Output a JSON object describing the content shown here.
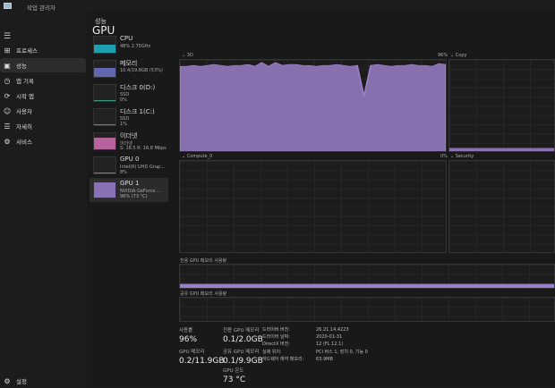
{
  "window": {
    "title": "작업 관리자"
  },
  "sidebar": {
    "items": [
      {
        "icon": "process-icon",
        "glyph": "⊞",
        "label": "프로세스"
      },
      {
        "icon": "performance-icon",
        "glyph": "▣",
        "label": "성능"
      },
      {
        "icon": "history-icon",
        "glyph": "◷",
        "label": "앱 기록"
      },
      {
        "icon": "startup-icon",
        "glyph": "⟳",
        "label": "시작 앱"
      },
      {
        "icon": "users-icon",
        "glyph": "☺",
        "label": "사용자"
      },
      {
        "icon": "details-icon",
        "glyph": "☰",
        "label": "자세히"
      },
      {
        "icon": "services-icon",
        "glyph": "⚙",
        "label": "서비스"
      }
    ],
    "settings": "설정"
  },
  "header": "성능",
  "perf_list": [
    {
      "name": "CPU",
      "sub1": "48% 2.75GHz",
      "color": "#1fb5c8",
      "fill": 48
    },
    {
      "name": "메모리",
      "sub1": "10.4/19.8GB (53%)",
      "color": "#6c72c9",
      "fill": 53
    },
    {
      "name": "디스크 0(D:)",
      "sub1": "SSD",
      "sub2": "0%",
      "color": "#3fae8f",
      "fill": 2
    },
    {
      "name": "디스크 1(C:)",
      "sub1": "SSD",
      "sub2": "1%",
      "color": "#3fae8f",
      "fill": 3
    },
    {
      "name": "이더넷",
      "sub1": "이더넷",
      "sub2": "S: 18.5 R: 16.8 Mbps",
      "color": "#d46fb4",
      "fill": 70
    },
    {
      "name": "GPU 0",
      "sub1": "Intel(R) UHD Grap...",
      "sub2": "8%",
      "color": "#9b7fcf",
      "fill": 8
    },
    {
      "name": "GPU 1",
      "sub1": "NVIDIA GeForce ...",
      "sub2": "96% (73 °C)",
      "color": "#9b7fcf",
      "fill": 96
    }
  ],
  "gpu": {
    "title": "GPU",
    "accent": "#9b7fc8",
    "engines": [
      {
        "label": "3D",
        "max": "96%"
      },
      {
        "label": "Copy"
      },
      {
        "label": "Compute_0",
        "max": "0%"
      },
      {
        "label": "Security"
      }
    ],
    "dedicated_label": "전용 GPU 메모리 사용량",
    "shared_label": "공유 GPU 메모리 사용량",
    "series_3d": [
      93,
      93,
      94,
      93,
      94,
      95,
      94,
      93,
      94,
      94,
      95,
      93,
      97,
      93,
      97,
      94,
      95,
      95,
      94,
      94,
      93,
      94,
      94,
      95,
      94,
      93,
      94,
      60,
      94,
      95,
      94,
      93,
      94,
      94,
      95,
      94,
      94,
      93,
      96,
      95
    ],
    "series_copy": [
      3,
      3,
      3,
      3,
      3,
      3,
      3,
      3,
      3,
      3
    ],
    "dedicated_pct": 3,
    "stats": {
      "utilization_label": "사용률",
      "utilization": "96%",
      "gpu_mem_label": "GPU 메모리",
      "gpu_mem": "0.2/11.9GB",
      "dedicated_label": "전용 GPU 메모리",
      "dedicated": "0.1/2.0GB",
      "shared_label": "공유 GPU 메모리",
      "shared": "0.1/9.9GB",
      "temp_label": "GPU 온도",
      "temp": "73 °C"
    },
    "info": [
      {
        "k": "드라이버 버전:",
        "v": "26.21.14.4223"
      },
      {
        "k": "드라이버 날짜:",
        "v": "2020-01-31"
      },
      {
        "k": "DirectX 버전:",
        "v": "12 (FL 12.1)"
      },
      {
        "k": "실제 위치:",
        "v": "PCI 버스 1, 장치 0, 기능 0"
      },
      {
        "k": "하드웨어 예약 메모리:",
        "v": "63.9MB"
      }
    ]
  }
}
